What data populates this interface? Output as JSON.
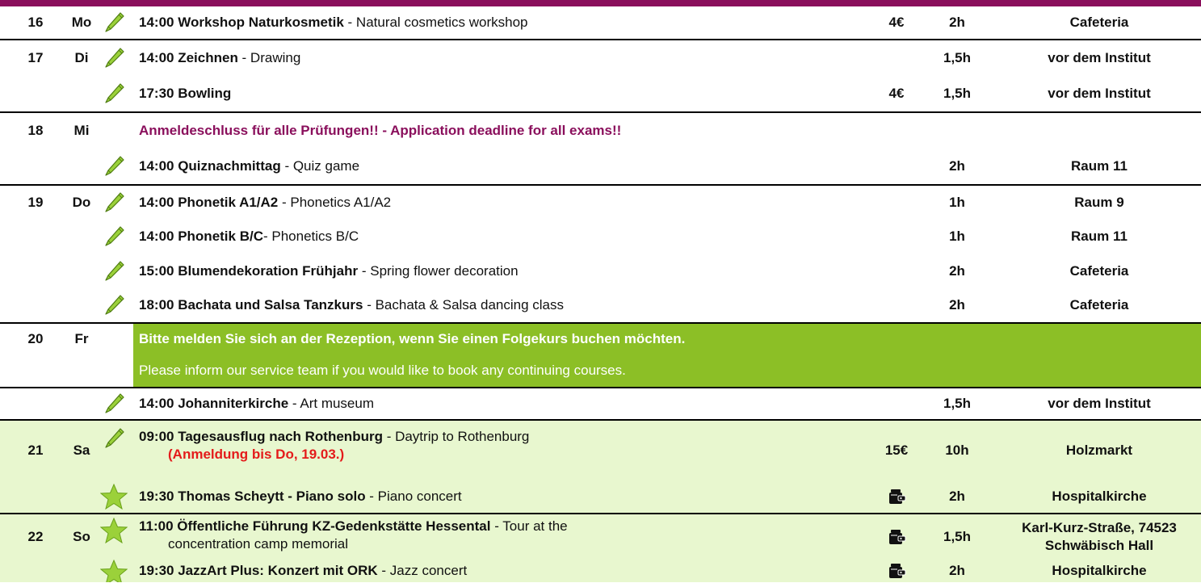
{
  "colors": {
    "header": "#8a0f5c",
    "accent_purple": "#8a0f5c",
    "green_bar": "#8cbf26",
    "light_green": "#e8f7cf",
    "red": "#e41b1b"
  },
  "rows": [
    {
      "day": "16",
      "weekday": "Mo",
      "icon": "pencil-icon",
      "time_title": "14:00 Workshop Naturkosmetik",
      "sub": " - Natural cosmetics workshop",
      "price": "4€",
      "duration": "2h",
      "location": "Cafeteria"
    },
    {
      "day": "17",
      "weekday": "Di",
      "icon": "pencil-icon",
      "time_title": "14:00 Zeichnen",
      "sub": " - Drawing",
      "price": "",
      "duration": "1,5h",
      "location": "vor dem Institut"
    },
    {
      "icon": "pencil-icon",
      "time_title": "17:30 Bowling",
      "sub": "",
      "price": "4€",
      "duration": "1,5h",
      "location": "vor dem Institut"
    },
    {
      "day": "18",
      "weekday": "Mi",
      "notice": "Anmeldeschluss für alle Prüfungen!! - Application deadline for all exams!!"
    },
    {
      "icon": "pencil-icon",
      "time_title": "14:00 Quiznachmittag",
      "sub": " - Quiz game",
      "duration": "2h",
      "location": "Raum 11"
    },
    {
      "day": "19",
      "weekday": "Do",
      "icon": "pencil-icon",
      "time_title": "14:00 Phonetik A1/A2",
      "sub": " - Phonetics A1/A2",
      "duration": "1h",
      "location": "Raum 9"
    },
    {
      "icon": "pencil-icon",
      "time_title": "14:00 Phonetik B/C",
      "sub": "- Phonetics B/C",
      "duration": "1h",
      "location": "Raum 11"
    },
    {
      "icon": "pencil-icon",
      "time_title": "15:00 Blumendekoration Frühjahr",
      "sub": " - Spring flower decoration",
      "duration": "2h",
      "location": "Cafeteria"
    },
    {
      "icon": "pencil-icon",
      "time_title": "18:00 Bachata und Salsa Tanzkurs",
      "sub": " - Bachata & Salsa dancing class",
      "duration": "2h",
      "location": "Cafeteria"
    },
    {
      "day": "20",
      "weekday": "Fr",
      "notice_de": "Bitte melden Sie sich an der Rezeption, wenn Sie einen Folgekurs buchen möchten.",
      "notice_en": "Please inform our service team if you would like to book any continuing courses."
    },
    {
      "icon": "pencil-icon",
      "time_title": "14:00 Johanniterkirche",
      "sub": " - Art museum",
      "duration": "1,5h",
      "location": "vor dem Institut"
    },
    {
      "day": "21",
      "weekday": "Sa",
      "icon": "pencil-icon",
      "time_title": "09:00 Tagesausflug nach Rothenburg",
      "sub": " - Daytrip to Rothenburg",
      "note": "(Anmeldung bis Do, 19.03.)",
      "price": "15€",
      "duration": "10h",
      "location": "Holzmarkt"
    },
    {
      "icon": "star-icon",
      "time_title": "19:30 Thomas Scheytt - Piano solo",
      "sub": " - Piano concert",
      "price_icon": "wallet-icon",
      "duration": "2h",
      "location": "Hospitalkirche"
    },
    {
      "day": "22",
      "weekday": "So",
      "icon": "star-icon",
      "time_title": "11:00 Öffentliche Führung KZ-Gedenkstätte Hessental",
      "sub": " - Tour at the",
      "sub2": "concentration camp memorial",
      "price_icon": "wallet-icon",
      "duration": "1,5h",
      "location": "Karl-Kurz-Straße, 74523 Schwäbisch Hall"
    },
    {
      "icon": "star-icon",
      "time_title": "19:30 JazzArt Plus: Konzert mit ORK",
      "sub": " - Jazz concert",
      "price_icon": "wallet-icon",
      "duration": "2h",
      "location": "Hospitalkirche"
    }
  ]
}
